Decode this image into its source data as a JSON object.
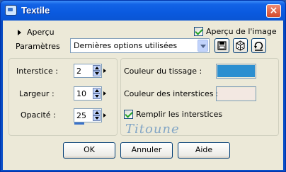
{
  "window": {
    "title": "Textile",
    "close_label": "×"
  },
  "preview": {
    "toggle_label": "Aperçu",
    "image_preview_label": "Aperçu de l'image",
    "image_preview_checked": true
  },
  "presets": {
    "label": "Paramètres",
    "selected": "Dernières options utilisées"
  },
  "settings": {
    "interstice_label": "Interstice :",
    "interstice_value": "2",
    "largeur_label": "Largeur :",
    "largeur_value": "10",
    "opacite_label": "Opacité :",
    "opacite_value": "25",
    "weave_color_label": "Couleur du tissage :",
    "weave_color": "#2c8fd0",
    "interstice_color_label": "Couleur des interstices :",
    "interstice_color": "#f3e8e2",
    "fill_interstices_label": "Remplir les interstices",
    "fill_interstices_checked": true
  },
  "watermark_text": "Titoune",
  "buttons": {
    "ok": "OK",
    "cancel": "Annuler",
    "help": "Aide"
  }
}
